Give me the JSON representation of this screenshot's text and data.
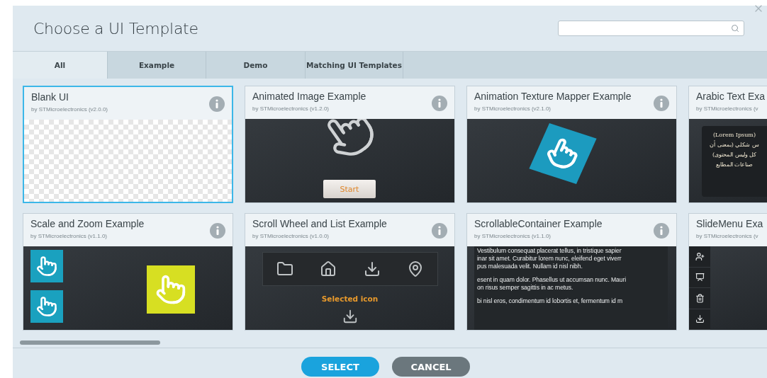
{
  "dialog": {
    "title": "Choose a UI Template"
  },
  "tabs": [
    {
      "label": "All",
      "selected": true
    },
    {
      "label": "Example",
      "selected": false
    },
    {
      "label": "Demo",
      "selected": false
    },
    {
      "label": "Matching UI Templates",
      "selected": false
    }
  ],
  "templates": [
    {
      "title": "Blank UI",
      "author": "by STMicroelectronics (v2.0.0)",
      "selected": true,
      "preview": {
        "kind": "blank"
      }
    },
    {
      "title": "Animated Image Example",
      "author": "by STMicroelectronics (v1.2.0)",
      "selected": false,
      "preview": {
        "kind": "animated-image",
        "button": "Start"
      }
    },
    {
      "title": "Animation Texture Mapper Example",
      "author": "by STMicroelectronics (v2.1.0)",
      "selected": false,
      "preview": {
        "kind": "texture-mapper"
      }
    },
    {
      "title": "Arabic Text Exa",
      "author": "by STMicroelectronics (v",
      "selected": false,
      "preview": {
        "kind": "arabic-text",
        "lines": [
          "(Lorem Ipsum)",
          "س شكلي (بمعنى أن",
          "كل وليس المحتوى)",
          "صناعات المطابع"
        ]
      }
    },
    {
      "title": "Scale and Zoom Example",
      "author": "by STMicroelectronics (v1.1.0)",
      "selected": false,
      "preview": {
        "kind": "scale-zoom"
      }
    },
    {
      "title": "Scroll Wheel and List Example",
      "author": "by STMicroelectronics (v1.0.0)",
      "selected": false,
      "preview": {
        "kind": "scroll-wheel",
        "caption": "Selected icon"
      }
    },
    {
      "title": "ScrollableContainer Example",
      "author": "by STMicroelectronics (v1.1.0)",
      "selected": false,
      "preview": {
        "kind": "scrollable-text",
        "paragraphs": [
          [
            "Vestibulum consequat placerat tellus, in tristique sapier",
            "inar sit amet. Curabitur lorem nunc, eleifend eget viverr",
            "pus malesuada velit. Nullam id nisl nibh."
          ],
          [
            "esent in quam dolor. Phasellus ut accumsan nunc. Mauri",
            "on risus semper sagittis in ac metus."
          ],
          [
            "bi nisl eros, condimentum id lobortis et, fermentum id m"
          ]
        ]
      }
    },
    {
      "title": "SlideMenu Exa",
      "author": "by STMicroelectronics (v",
      "selected": false,
      "preview": {
        "kind": "slide-menu"
      }
    }
  ],
  "buttons": [
    {
      "label": "SELECT",
      "kind": "primary"
    },
    {
      "label": "CANCEL",
      "kind": "secondary"
    }
  ]
}
